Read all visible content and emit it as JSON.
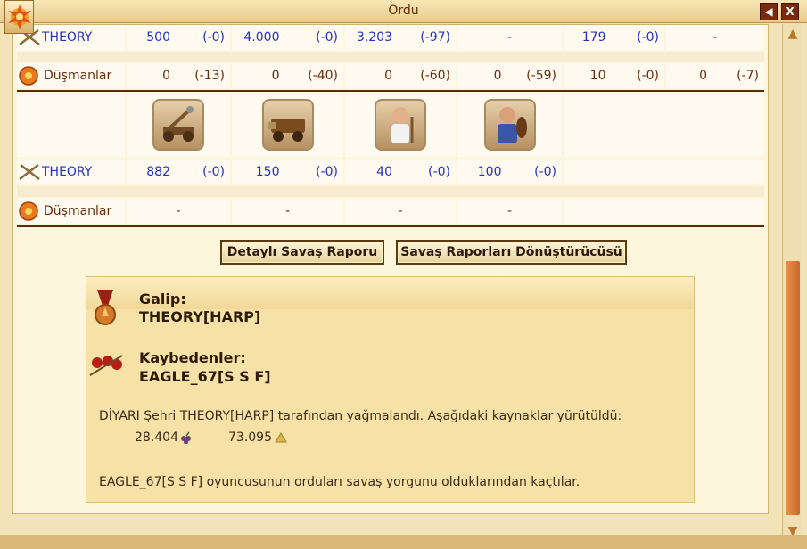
{
  "window": {
    "title": "Ordu",
    "back_glyph": "◀",
    "close_glyph": "X"
  },
  "scroll": {
    "up": "▲",
    "down": "▼"
  },
  "table1": {
    "theory": {
      "name": "THEORY",
      "cells": [
        [
          "500",
          "(-0)"
        ],
        [
          "4.000",
          "(-0)"
        ],
        [
          "3.203",
          "(-97)"
        ],
        [
          "-",
          ""
        ],
        [
          "179",
          "(-0)"
        ],
        [
          "-",
          ""
        ]
      ]
    },
    "enemies": {
      "name": "Düşmanlar",
      "cells": [
        [
          "0",
          "(-13)"
        ],
        [
          "0",
          "(-40)"
        ],
        [
          "0",
          "(-60)"
        ],
        [
          "0",
          "(-59)"
        ],
        [
          "10",
          "(-0)"
        ],
        [
          "0",
          "(-7)"
        ]
      ]
    }
  },
  "table2": {
    "units": [
      "catapult-icon",
      "ram-icon",
      "doctor-icon",
      "warrior-icon"
    ],
    "theory": {
      "name": "THEORY",
      "cells": [
        [
          "882",
          "(-0)"
        ],
        [
          "150",
          "(-0)"
        ],
        [
          "40",
          "(-0)"
        ],
        [
          "100",
          "(-0)"
        ]
      ]
    },
    "enemies": {
      "name": "Düşmanlar",
      "cells": [
        "-",
        "-",
        "-",
        "-"
      ]
    }
  },
  "buttons": {
    "detailed": "Detaylı Savaş Raporu",
    "converter": "Savaş Raporları Dönüştürücüsü"
  },
  "report": {
    "winner_label": "Galip:",
    "winner": "THEORY[HARP]",
    "losers_label": "Kaybedenler:",
    "loser": "EAGLE_67[S S F]",
    "plunder_text": "DİYARI Şehri THEORY[HARP] tarafından yağmalandı. Aşağıdaki kaynaklar yürütüldü:",
    "res1": "28.404",
    "res2": "73.095",
    "fled_text": "EAGLE_67[S S F] oyuncusunun orduları savaş yorgunu olduklarından kaçtılar."
  }
}
